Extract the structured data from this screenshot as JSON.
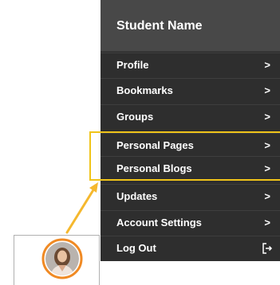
{
  "menu": {
    "header_title": "Student Name",
    "items": [
      {
        "label": "Profile",
        "icon": "chevron-right-icon"
      },
      {
        "label": "Bookmarks",
        "icon": "chevron-right-icon"
      },
      {
        "label": "Groups",
        "icon": "chevron-right-icon"
      },
      {
        "label": "Personal Pages",
        "icon": "chevron-right-icon"
      },
      {
        "label": "Personal Blogs",
        "icon": "chevron-right-icon"
      },
      {
        "label": "Updates",
        "icon": "chevron-right-icon"
      },
      {
        "label": "Account Settings",
        "icon": "chevron-right-icon"
      },
      {
        "label": "Log Out",
        "icon": "logout-icon"
      }
    ],
    "chevron_glyph": ">"
  },
  "colors": {
    "menu_background": "#2e2e2e",
    "header_background": "#484848",
    "highlight": "#f0c419",
    "arrow": "#f5b82e",
    "avatar_ring": "#f08a24"
  }
}
